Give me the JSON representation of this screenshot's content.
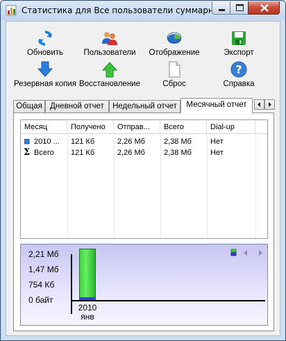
{
  "window": {
    "title": "Статистика для Все пользователи суммарно"
  },
  "toolbar": {
    "row1": [
      {
        "label": "Обновить",
        "icon": "refresh-icon"
      },
      {
        "label": "Пользователи",
        "icon": "users-icon"
      },
      {
        "label": "Отображение",
        "icon": "display-icon"
      },
      {
        "label": "Экспорт",
        "icon": "export-icon"
      }
    ],
    "row2": [
      {
        "label": "Резервная копия",
        "icon": "backup-icon"
      },
      {
        "label": "Восстановление",
        "icon": "restore-icon"
      },
      {
        "label": "Сброс",
        "icon": "reset-icon"
      },
      {
        "label": "Справка",
        "icon": "help-icon"
      }
    ]
  },
  "tabs": [
    {
      "label": "Общая",
      "active": false
    },
    {
      "label": "Дневной отчет",
      "active": false
    },
    {
      "label": "Недельный отчет",
      "active": false
    },
    {
      "label": "Месячный отчет",
      "active": true
    }
  ],
  "table": {
    "columns": [
      "Месяц",
      "Получено",
      "Отправ...",
      "Всего",
      "Dial-up"
    ],
    "rows": [
      {
        "icon": "month-icon",
        "cells": [
          "2010 ...",
          "121 Кб",
          "2,26 Мб",
          "2,38 Мб",
          "Нет"
        ]
      },
      {
        "icon": "sum-icon",
        "cells": [
          "Всего",
          "121 Кб",
          "2,26 Мб",
          "2,38 Мб",
          "Нет"
        ]
      }
    ]
  },
  "chart_data": {
    "type": "bar",
    "categories": [
      "2010 янв"
    ],
    "category_lines": [
      [
        "2010",
        "янв"
      ]
    ],
    "series": [
      {
        "values": [
          2.38
        ],
        "color": "#3ed43e"
      },
      {
        "values": [
          0.12
        ],
        "color": "#2b3fd6"
      }
    ],
    "y_unit": "Мб",
    "y_ticks": [
      "2,21 Мб",
      "1,47 Мб",
      "754 Кб",
      "0 байт"
    ],
    "y_tick_values": [
      2.21,
      1.47,
      0.736,
      0
    ],
    "ylim": [
      0,
      2.21
    ]
  },
  "colors": {
    "accent": "#3ed43e",
    "chart_bg": "#d9d7fa"
  }
}
